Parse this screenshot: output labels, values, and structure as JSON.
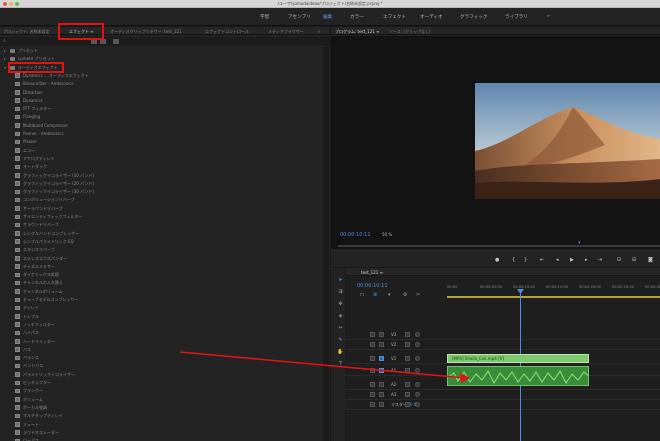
{
  "window": {
    "title": "/ユーザ/yamadaideao/プロジェクト/名称未設定.prproj *"
  },
  "workspaces": [
    {
      "label": "学習",
      "active": false
    },
    {
      "label": "アセンブリ",
      "active": false
    },
    {
      "label": "編集",
      "active": true
    },
    {
      "label": "カラー",
      "active": false
    },
    {
      "label": "エフェクト",
      "active": false
    },
    {
      "label": "オーディオ",
      "active": false
    },
    {
      "label": "グラフィック",
      "active": false
    },
    {
      "label": "ライブラリ",
      "active": false
    }
  ],
  "left_panel": {
    "tabs": [
      {
        "label": "プロジェクト: 名称未設定",
        "active": false
      },
      {
        "label": "エフェクト ≡",
        "active": true
      },
      {
        "label": "オーディオクリップミキサー: test_121",
        "active": false
      },
      {
        "label": "エフェクトコントロール",
        "active": false
      },
      {
        "label": "メディアブラウザー",
        "active": false
      }
    ],
    "search_icon": "search-icon",
    "categories": [
      {
        "label": "プリセット"
      },
      {
        "label": "Lumetri プリセット"
      },
      {
        "label": "オーディオエフェクト"
      }
    ],
    "effects": [
      "Dynamics ... オーディオエフェクト",
      "Binauralizer - Ambisonics",
      "Distortion",
      "Dynamics",
      "FFT フィルター",
      "Flanging",
      "Multiband Compressor",
      "Panner - Ambisonics",
      "Phaser",
      "エコー",
      "アナログディレイ",
      "オートダック",
      "グラフィックイコライザー (10 バンド)",
      "グラフィックイコライザー (20 バンド)",
      "グラフィックイコライザー (30 バンド)",
      "コンボリューションリバーブ",
      "サーラウンドリバーブ",
      "サイエンティフィックフィルター",
      "サラウンドリバーブ",
      "シングルバンドコンプレッサー",
      "シンプルパラメトリック EQ",
      "スタジオリバーブ",
      "ステレオエクスパンダー",
      "チャネルミキサー",
      "ダイナミックス処理",
      "チャンネルの入れ替え",
      "チャンネルボリューム",
      "チューブモデルコンプレッサー",
      "ディレイ",
      "トレブル",
      "ノッチフィルター",
      "ハイパス",
      "ハードリミッター",
      "バス",
      "バランス",
      "バンドパス",
      "パラメトリックイコライザー",
      "ピッチシフター",
      "ブランクー",
      "ボリューム",
      "ボーカル強調",
      "マルチタップディレイ",
      "ミュート",
      "ラウドネスレーダー",
      "ローパス"
    ]
  },
  "program_monitor": {
    "tabs": [
      {
        "label": "プログラム: test_121 ≡",
        "active": true
      },
      {
        "label": "ソース: (クリップなし)",
        "active": false
      }
    ],
    "timecode": "00:00:10:11",
    "fit": "50 %",
    "controls": [
      "marker-icon",
      "in-point-icon",
      "out-point-icon",
      "go-to-in-icon",
      "step-back-icon",
      "play-icon",
      "step-forward-icon",
      "go-to-out-icon",
      "insert-icon",
      "overwrite-icon",
      "export-frame-icon"
    ]
  },
  "timeline": {
    "tab": "test_121 ≡",
    "timecode": "00:00:10:11",
    "ruler_labels": [
      "00:00",
      "00:00:05:00",
      "00:00:10:00",
      "00:00:15:00",
      "00:00:20:00",
      "00:00:25:00",
      "00:00:30:00"
    ],
    "video_clip": "[MP4] Sheila_Cvk.mp4 [V]",
    "tracks": [
      {
        "name": "V3"
      },
      {
        "name": "V2"
      },
      {
        "name": "V1"
      },
      {
        "name": "A1"
      },
      {
        "name": "A2"
      },
      {
        "name": "A3"
      },
      {
        "name": "マスター"
      }
    ],
    "master_value": "0.0"
  },
  "annotation": {
    "color": "#e01414"
  },
  "colors": {
    "accent": "#4f8ee0",
    "clip_green": "#6fc46a",
    "highlight": "#e01414"
  }
}
